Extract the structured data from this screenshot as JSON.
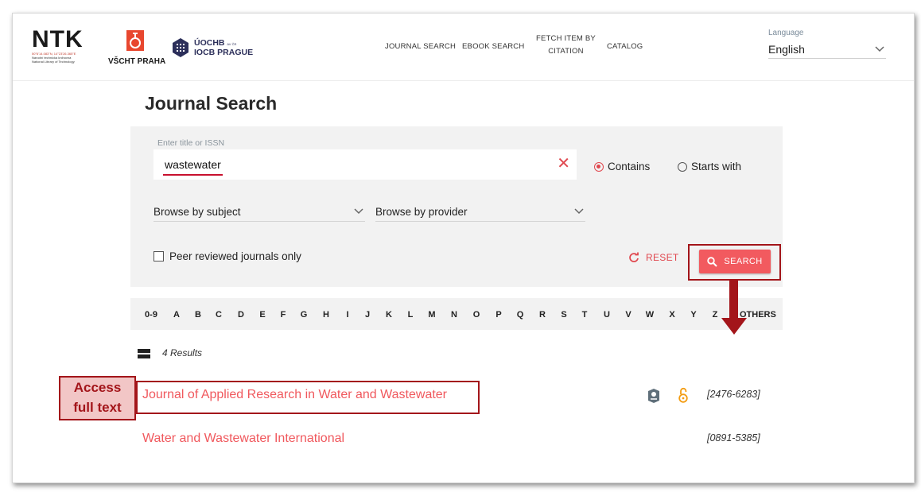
{
  "header": {
    "ntk": {
      "word": "NTK",
      "coords": "50°6'14.083\"N, 14°23'26.365\"E",
      "sub1": "Národní technická knihovna",
      "sub2": "National Library of Technology"
    },
    "vscht": {
      "name": "VŠCHT PRAHA"
    },
    "uochb": {
      "line1": "ÚOCHB",
      "line1_small": "AV ČR",
      "line2": "IOCB PRAGUE"
    },
    "nav": [
      {
        "label": "JOURNAL SEARCH"
      },
      {
        "label": "EBOOK SEARCH"
      },
      {
        "label_line1": "FETCH ITEM BY",
        "label_line2": "CITATION"
      },
      {
        "label": "CATALOG"
      }
    ],
    "language": {
      "label": "Language",
      "value": "English"
    }
  },
  "page": {
    "title": "Journal Search"
  },
  "search": {
    "label": "Enter title or ISSN",
    "value": "wastewater",
    "clear_glyph": "✕",
    "mode_contains": "Contains",
    "mode_starts": "Starts with",
    "selected_mode": "contains",
    "subject_dropdown": "Browse by subject",
    "provider_dropdown": "Browse by provider",
    "peer_reviewed": "Peer reviewed journals only",
    "reset": "RESET",
    "search": "SEARCH"
  },
  "alphabet": [
    "0-9",
    "A",
    "B",
    "C",
    "D",
    "E",
    "F",
    "G",
    "H",
    "I",
    "J",
    "K",
    "L",
    "M",
    "N",
    "O",
    "P",
    "Q",
    "R",
    "S",
    "T",
    "U",
    "V",
    "W",
    "X",
    "Y",
    "Z",
    "OTHERS"
  ],
  "results": {
    "count": "4 Results",
    "items": [
      {
        "title": "Journal of Applied Research in Water and Wastewater",
        "issn": "[2476-6283]",
        "icons": [
          "peer-reviewed-icon",
          "open-access-icon"
        ]
      },
      {
        "title": "Water and Wastewater International",
        "issn": "[0891-5385]",
        "icons": []
      }
    ]
  },
  "annotation": {
    "callout_line1": "Access",
    "callout_line2": "full text"
  },
  "colors": {
    "accent": "#f0585d",
    "button": "#f25a5f",
    "annotation": "#a3151a",
    "callout_bg": "#f2c6c6",
    "panel": "#f2f2f2"
  }
}
